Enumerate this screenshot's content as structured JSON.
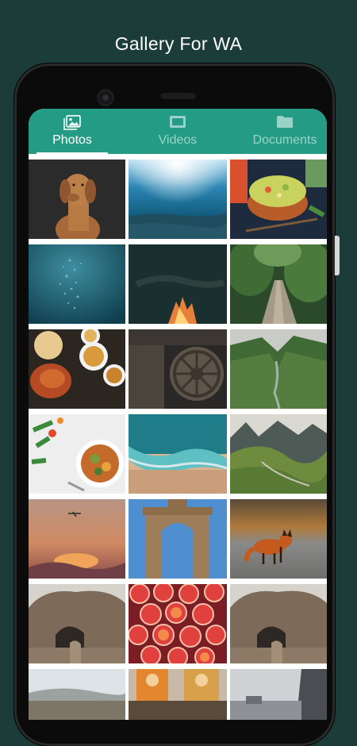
{
  "promo": {
    "title": "Gallery For WA"
  },
  "tabs": [
    {
      "label": "Photos",
      "icon": "photo-icon",
      "active": true
    },
    {
      "label": "Videos",
      "icon": "video-icon",
      "active": false
    },
    {
      "label": "Documents",
      "icon": "document-icon",
      "active": false
    }
  ],
  "colors": {
    "background": "#1b3c38",
    "appbar": "#239b85",
    "tab_active": "#ffffff"
  },
  "photos": [
    {
      "name": "photo-dog"
    },
    {
      "name": "photo-underwater-sunrays"
    },
    {
      "name": "photo-food-bowl"
    },
    {
      "name": "photo-bubbles"
    },
    {
      "name": "photo-campfire"
    },
    {
      "name": "photo-forest-path"
    },
    {
      "name": "photo-food-platter"
    },
    {
      "name": "photo-stone-wheel"
    },
    {
      "name": "photo-green-valley"
    },
    {
      "name": "photo-salad"
    },
    {
      "name": "photo-beach-aerial"
    },
    {
      "name": "photo-mountain-valley"
    },
    {
      "name": "photo-sunset-plane"
    },
    {
      "name": "photo-india-gate"
    },
    {
      "name": "photo-fox"
    },
    {
      "name": "photo-rock-arch-1"
    },
    {
      "name": "photo-grapefruit"
    },
    {
      "name": "photo-rock-arch-2"
    },
    {
      "name": "photo-coastline"
    },
    {
      "name": "photo-shrine"
    },
    {
      "name": "photo-street"
    }
  ]
}
